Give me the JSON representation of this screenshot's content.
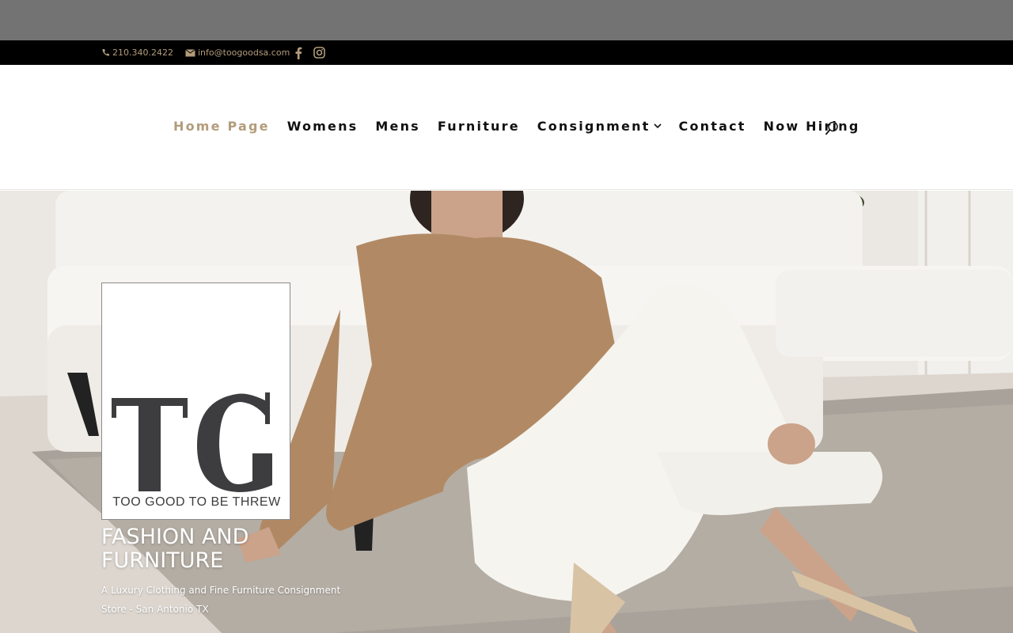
{
  "top_bar": {
    "phone": "210.340.2422",
    "email": "info@toogoodsa.com",
    "social": [
      "facebook-icon",
      "instagram-icon"
    ],
    "text_color": "#b39c7b",
    "background": "#000000"
  },
  "nav": {
    "items": [
      {
        "label": "Home Page",
        "active": true
      },
      {
        "label": "Womens"
      },
      {
        "label": "Mens"
      },
      {
        "label": "Furniture"
      },
      {
        "label": "Consignment",
        "has_dropdown": true
      },
      {
        "label": "Contact"
      },
      {
        "label": "Now Hiring"
      }
    ],
    "active_color": "#b39c7b",
    "search_icon": "search-icon"
  },
  "logo": {
    "monogram": "TG",
    "tagline": "TOO GOOD TO BE THREW"
  },
  "hero": {
    "title": "FASHION AND FURNITURE",
    "subtitle": "A Luxury Clothing and Fine Furniture Consignment Store - San Antonio TX"
  }
}
